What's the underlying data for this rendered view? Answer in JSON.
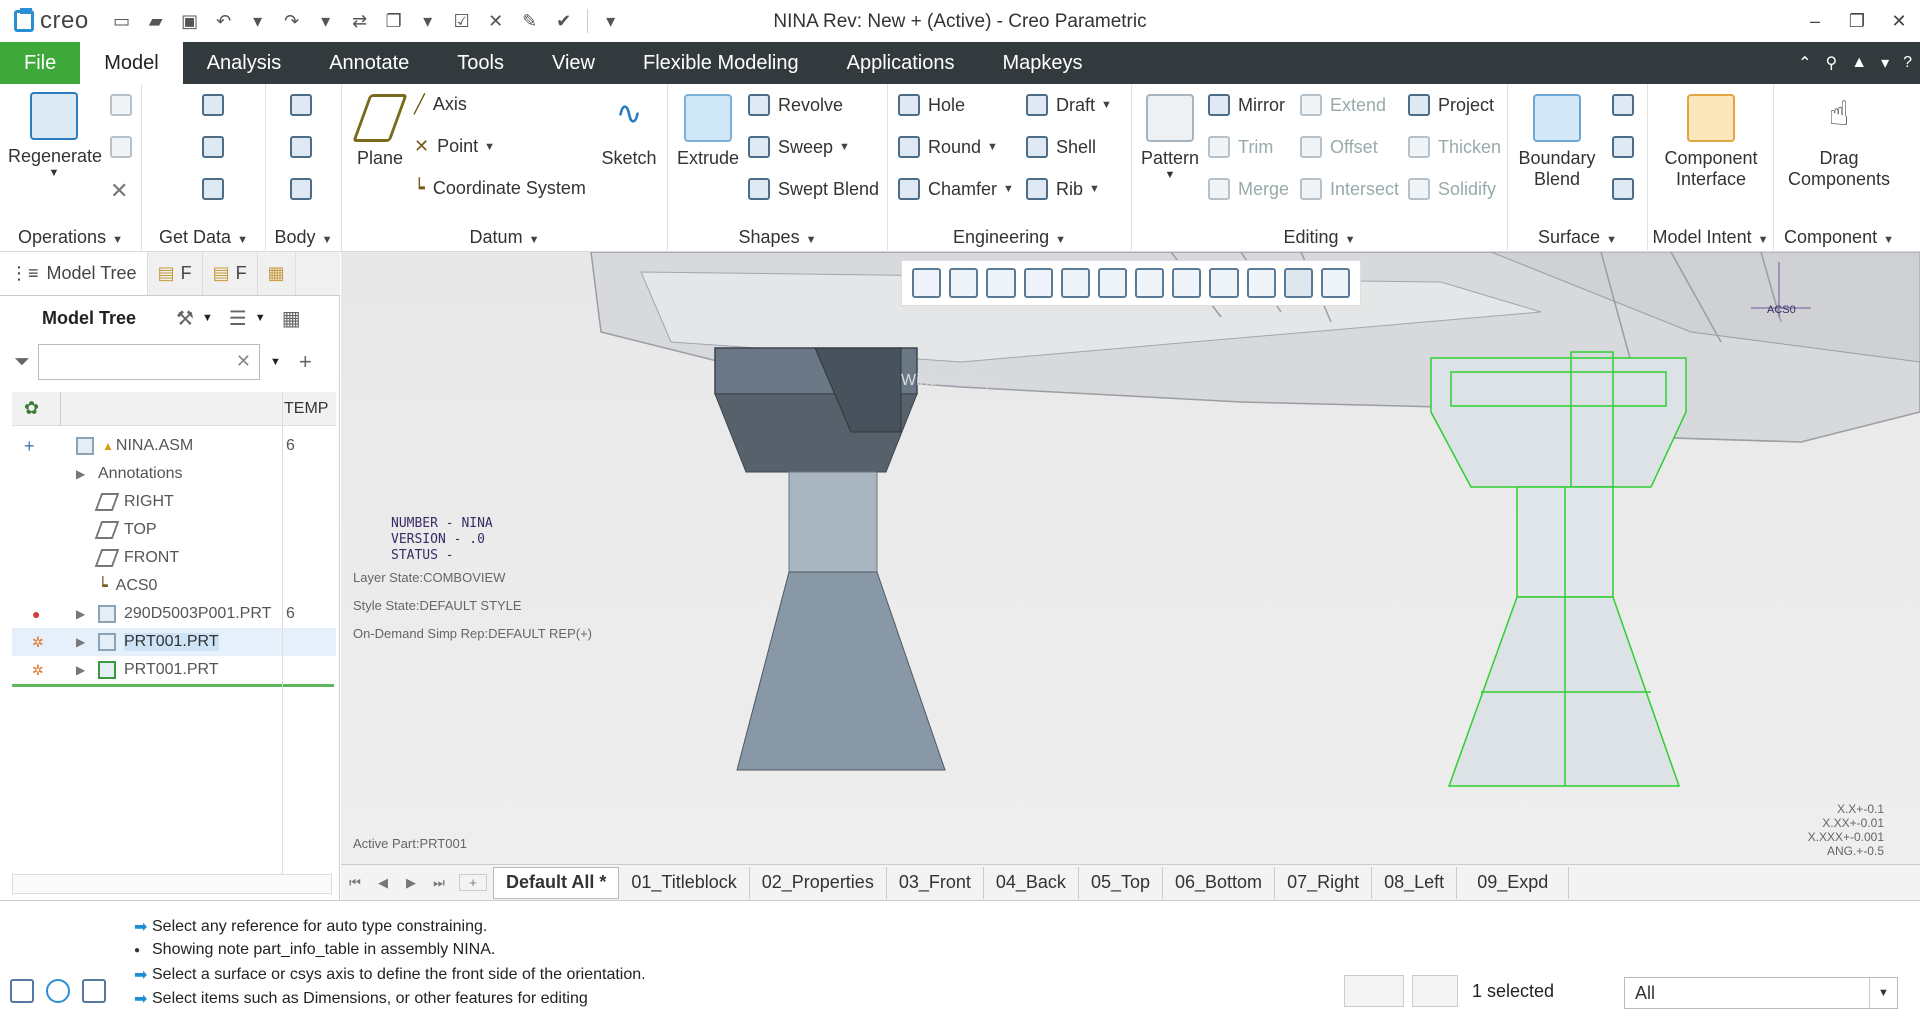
{
  "app": {
    "logo_text": "creo",
    "window_title": "NINA Rev: New + (Active) - Creo Parametric"
  },
  "tabs": [
    {
      "label": "File"
    },
    {
      "label": "Model"
    },
    {
      "label": "Analysis"
    },
    {
      "label": "Annotate"
    },
    {
      "label": "Tools"
    },
    {
      "label": "View"
    },
    {
      "label": "Flexible Modeling"
    },
    {
      "label": "Applications"
    },
    {
      "label": "Mapkeys"
    }
  ],
  "ribbon": {
    "operations": {
      "regenerate": "Regenerate",
      "label": "Operations"
    },
    "get_data": {
      "label": "Get Data"
    },
    "body": {
      "label": "Body"
    },
    "datum": {
      "plane": "Plane",
      "axis": "Axis",
      "point": "Point",
      "csys": "Coordinate System",
      "sketch": "Sketch",
      "label": "Datum"
    },
    "shapes": {
      "extrude": "Extrude",
      "revolve": "Revolve",
      "sweep": "Sweep",
      "swept_blend": "Swept Blend",
      "label": "Shapes"
    },
    "engineering": {
      "hole": "Hole",
      "round": "Round",
      "chamfer": "Chamfer",
      "draft": "Draft",
      "shell": "Shell",
      "rib": "Rib",
      "label": "Engineering"
    },
    "editing": {
      "pattern": "Pattern",
      "mirror": "Mirror",
      "trim": "Trim",
      "merge": "Merge",
      "extend": "Extend",
      "offset": "Offset",
      "intersect": "Intersect",
      "project": "Project",
      "thicken": "Thicken",
      "solidify": "Solidify",
      "label": "Editing"
    },
    "surface": {
      "boundary_blend_1": "Boundary",
      "boundary_blend_2": "Blend",
      "label": "Surface"
    },
    "model_intent": {
      "component_interface_1": "Component",
      "component_interface_2": "Interface",
      "label": "Model Intent"
    },
    "component": {
      "drag_1": "Drag",
      "drag_2": "Components",
      "label": "Component"
    }
  },
  "left_panel": {
    "tab_model_tree": "Model Tree",
    "tab_2": "F",
    "tab_3": "F",
    "header_title": "Model Tree",
    "filter_placeholder": "",
    "col_temp": "TEMP",
    "rows": [
      {
        "label": "NINA.ASM",
        "num": "6"
      },
      {
        "label": "Annotations",
        "num": ""
      },
      {
        "label": "RIGHT",
        "num": ""
      },
      {
        "label": "TOP",
        "num": ""
      },
      {
        "label": "FRONT",
        "num": ""
      },
      {
        "label": "ACS0",
        "num": ""
      },
      {
        "label": "290D5003P001.PRT",
        "num": "6"
      },
      {
        "label": "PRT001.PRT",
        "num": ""
      },
      {
        "label": "PRT001.PRT",
        "num": ""
      }
    ]
  },
  "viewport": {
    "note_text": "NUMBER - NINA\nVERSION - .0\nSTATUS -",
    "layer_state": "Layer State:COMBOVIEW",
    "style_state": "Style State:DEFAULT STYLE",
    "simp_rep": "On-Demand Simp Rep:DEFAULT REP(+)",
    "active_part": "Active Part:PRT001",
    "ghost_text": "Window Ship",
    "csys_label": "ACS0",
    "tolerance": [
      "X.X+-0.1",
      "X.XX+-0.01",
      "X.XXX+-0.001",
      "ANG.+-0.5"
    ]
  },
  "sheet_tabs": [
    "Default All *",
    "01_Titleblock",
    "02_Properties",
    "03_Front",
    "04_Back",
    "05_Top",
    "06_Bottom",
    "07_Right",
    "08_Left",
    "09_Expd"
  ],
  "status": {
    "messages": [
      "Select any reference for auto type constraining.",
      "Showing note part_info_table in assembly NINA.",
      "Select a surface or csys axis to define the front side of the orientation.",
      "Select items such as Dimensions, or other features for editing"
    ],
    "selected_count": "1 selected",
    "filter_value": "All"
  },
  "colors": {
    "file_tab": "#3ea93a",
    "tab_bar": "#333a3e",
    "accent": "#1d8fd2",
    "selected_wire": "#2fcf2f"
  }
}
